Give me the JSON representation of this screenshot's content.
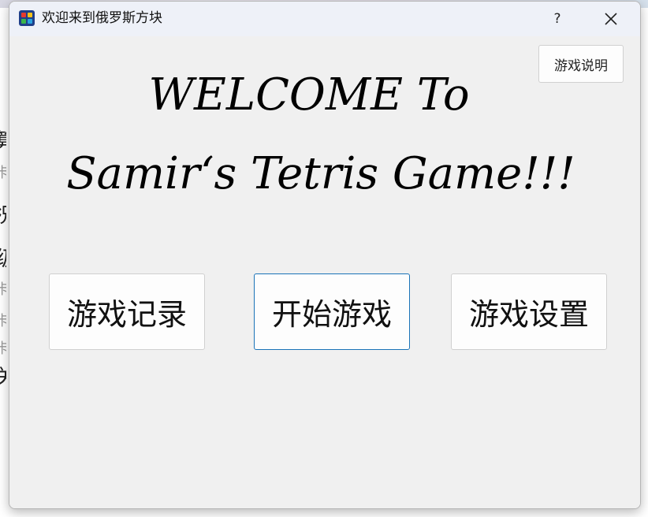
{
  "background": {
    "side_chars": [
      "算",
      "卡",
      "况",
      "级",
      "卡",
      "卡",
      "卡",
      "关"
    ]
  },
  "window": {
    "title": "欢迎来到俄罗斯方块",
    "help_label": "?",
    "close_label": "✕"
  },
  "main": {
    "instructions_label": "游戏说明",
    "welcome_line1": "WELCOME To",
    "welcome_line2": "Samir‘s Tetris Game!!!",
    "buttons": [
      {
        "label": "游戏记录"
      },
      {
        "label": "开始游戏"
      },
      {
        "label": "游戏设置"
      }
    ]
  },
  "icons": {
    "app": "tetris-app-icon",
    "help": "question-mark-icon",
    "close": "close-icon"
  }
}
